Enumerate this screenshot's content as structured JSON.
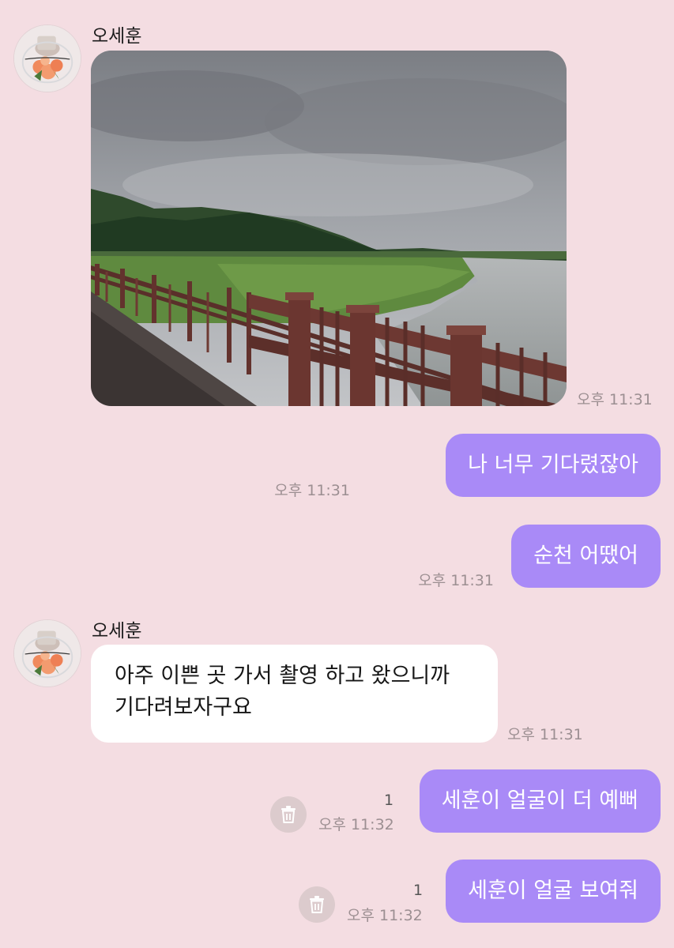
{
  "contact": {
    "name": "오세훈"
  },
  "messages": [
    {
      "type": "photo",
      "time": "오후 11:31"
    },
    {
      "type": "text",
      "text": "나 너무 기다렸잖아",
      "time": "오후 11:31"
    },
    {
      "type": "text",
      "text": "순천 어땠어",
      "time": "오후 11:31"
    },
    {
      "type": "text",
      "text_line1": "아주 이쁜 곳 가서 촬영 하고 왔으니까",
      "text_line2": "기다려보자구요",
      "time": "오후 11:31"
    },
    {
      "type": "text",
      "text": "세훈이 얼굴이 더 예뻐",
      "time": "오후 11:32",
      "unread": "1",
      "action_icon": "trash-icon"
    },
    {
      "type": "text",
      "text": "세훈이 얼굴 보여줘",
      "time": "오후 11:32",
      "unread": "1",
      "action_icon": "trash-icon"
    }
  ],
  "colors": {
    "background": "#f4dde2",
    "outgoing_bubble": "#a98af7",
    "incoming_bubble": "#ffffff",
    "timestamp": "#9c8f92"
  }
}
